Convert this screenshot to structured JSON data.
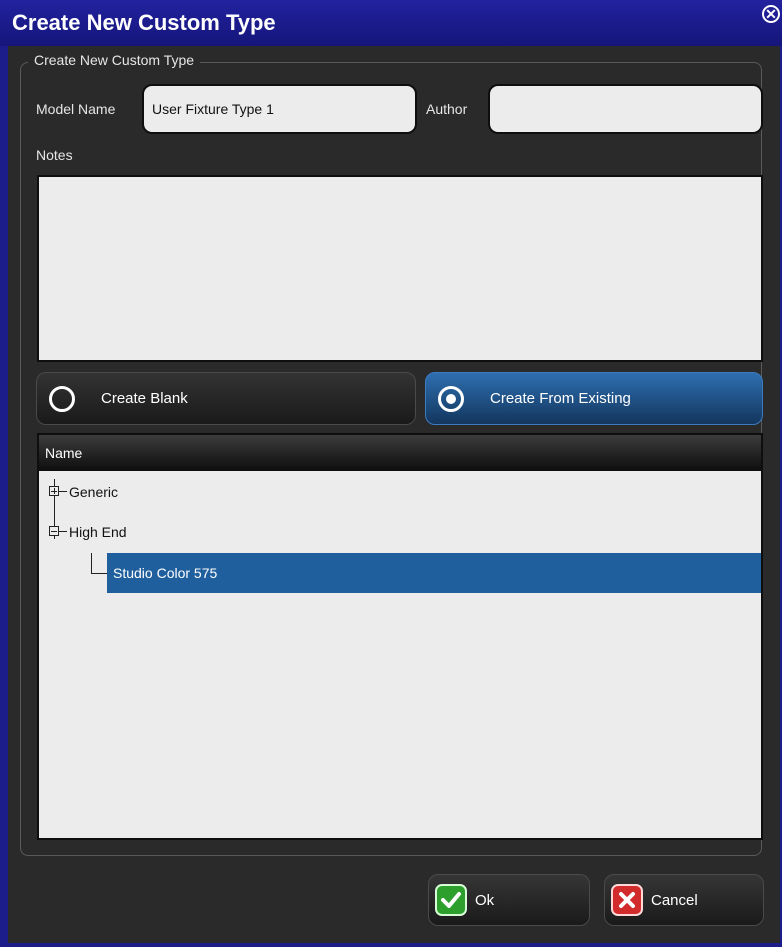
{
  "window": {
    "title": "Create New Custom Type"
  },
  "group": {
    "legend": "Create New Custom Type"
  },
  "form": {
    "model_name_label": "Model Name",
    "model_name_value": "User Fixture Type 1",
    "author_label": "Author",
    "author_value": "",
    "notes_label": "Notes",
    "notes_value": ""
  },
  "mode": {
    "options": [
      {
        "label": "Create Blank",
        "selected": false
      },
      {
        "label": "Create From Existing",
        "selected": true
      }
    ]
  },
  "tree": {
    "column_header": "Name",
    "nodes": [
      {
        "label": "Generic",
        "expanded": false
      },
      {
        "label": "High End",
        "expanded": true,
        "children": [
          {
            "label": "Studio Color 575",
            "selected": true
          }
        ]
      }
    ]
  },
  "buttons": {
    "ok": "Ok",
    "cancel": "Cancel"
  },
  "colors": {
    "title_bar": "#1c1c8a",
    "selection": "#1f5f9e",
    "ok_icon": "#2d9f2d",
    "cancel_icon": "#d22b2b"
  },
  "icons": {
    "close": "close-icon",
    "ok": "checkmark-icon",
    "cancel": "x-icon"
  }
}
